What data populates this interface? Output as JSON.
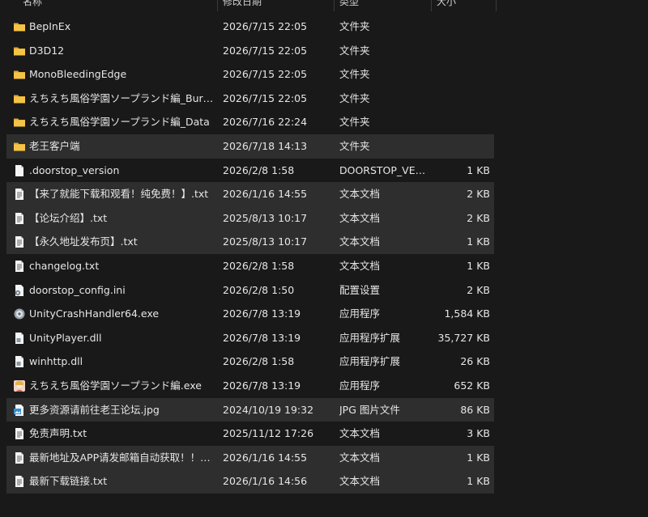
{
  "header": {
    "name": "名称",
    "date": "修改日期",
    "type": "类型",
    "size": "大小"
  },
  "rows": [
    {
      "name": "BepInEx",
      "date": "2026/7/15 22:05",
      "type": "文件夹",
      "size": "",
      "icon": "folder-icon",
      "selected": false
    },
    {
      "name": "D3D12",
      "date": "2026/7/15 22:05",
      "type": "文件夹",
      "size": "",
      "icon": "folder-icon",
      "selected": false
    },
    {
      "name": "MonoBleedingEdge",
      "date": "2026/7/15 22:05",
      "type": "文件夹",
      "size": "",
      "icon": "folder-icon",
      "selected": false
    },
    {
      "name": "えちえち風俗学園ソープランド編_Burst…",
      "date": "2026/7/15 22:05",
      "type": "文件夹",
      "size": "",
      "icon": "folder-icon",
      "selected": false
    },
    {
      "name": "えちえち風俗学園ソープランド編_Data",
      "date": "2026/7/16 22:24",
      "type": "文件夹",
      "size": "",
      "icon": "folder-icon",
      "selected": false
    },
    {
      "name": "老王客户端",
      "date": "2026/7/18 14:13",
      "type": "文件夹",
      "size": "",
      "icon": "folder-icon",
      "selected": true
    },
    {
      "name": ".doorstop_version",
      "date": "2026/2/8 1:58",
      "type": "DOORSTOP_VER...",
      "size": "1 KB",
      "icon": "file-icon",
      "selected": false
    },
    {
      "name": "【来了就能下载和观看！纯免费！】.txt",
      "date": "2026/1/16 14:55",
      "type": "文本文档",
      "size": "2 KB",
      "icon": "text-file-icon",
      "selected": true
    },
    {
      "name": "【论坛介绍】.txt",
      "date": "2025/8/13 10:17",
      "type": "文本文档",
      "size": "2 KB",
      "icon": "text-file-icon",
      "selected": true
    },
    {
      "name": "【永久地址发布页】.txt",
      "date": "2025/8/13 10:17",
      "type": "文本文档",
      "size": "1 KB",
      "icon": "text-file-icon",
      "selected": true
    },
    {
      "name": "changelog.txt",
      "date": "2026/2/8 1:58",
      "type": "文本文档",
      "size": "1 KB",
      "icon": "text-file-icon",
      "selected": false
    },
    {
      "name": "doorstop_config.ini",
      "date": "2026/2/8 1:50",
      "type": "配置设置",
      "size": "2 KB",
      "icon": "settings-file-icon",
      "selected": false
    },
    {
      "name": "UnityCrashHandler64.exe",
      "date": "2026/7/8 13:19",
      "type": "应用程序",
      "size": "1,584 KB",
      "icon": "unity-exe-icon",
      "selected": false
    },
    {
      "name": "UnityPlayer.dll",
      "date": "2026/7/8 13:19",
      "type": "应用程序扩展",
      "size": "35,727 KB",
      "icon": "dll-file-icon",
      "selected": false
    },
    {
      "name": "winhttp.dll",
      "date": "2026/2/8 1:58",
      "type": "应用程序扩展",
      "size": "26 KB",
      "icon": "dll-file-icon",
      "selected": false
    },
    {
      "name": "えちえち風俗学園ソープランド編.exe",
      "date": "2026/7/8 13:19",
      "type": "应用程序",
      "size": "652 KB",
      "icon": "game-exe-icon",
      "selected": false
    },
    {
      "name": "更多资源请前往老王论坛.jpg",
      "date": "2024/10/19 19:32",
      "type": "JPG 图片文件",
      "size": "86 KB",
      "icon": "image-file-icon",
      "selected": true
    },
    {
      "name": "免责声明.txt",
      "date": "2025/11/12 17:26",
      "type": "文本文档",
      "size": "3 KB",
      "icon": "text-file-icon",
      "selected": false
    },
    {
      "name": "最新地址及APP请发邮箱自动获取！！！...",
      "date": "2026/1/16 14:55",
      "type": "文本文档",
      "size": "1 KB",
      "icon": "text-file-icon",
      "selected": true
    },
    {
      "name": "最新下载链接.txt",
      "date": "2026/1/16 14:56",
      "type": "文本文档",
      "size": "1 KB",
      "icon": "text-file-icon",
      "selected": true
    }
  ]
}
